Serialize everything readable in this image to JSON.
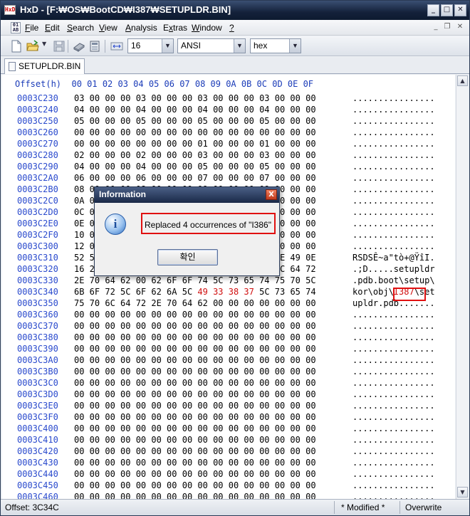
{
  "window": {
    "title": "HxD - [F:₩OS₩BootCD₩I387₩SETUPLDR.BIN]"
  },
  "menu": {
    "items": [
      {
        "label": "File",
        "u": "F",
        "rest": "ile"
      },
      {
        "label": "Edit",
        "u": "E",
        "rest": "dit"
      },
      {
        "label": "Search",
        "u": "S",
        "rest": "earch"
      },
      {
        "label": "View",
        "u": "V",
        "rest": "iew"
      },
      {
        "label": "Analysis",
        "u": "A",
        "rest": "nalysis"
      },
      {
        "label": "Extras",
        "u": "x",
        "pre": "E",
        "rest": "tras"
      },
      {
        "label": "Window",
        "u": "W",
        "rest": "indow"
      },
      {
        "label": "?",
        "u": "?",
        "rest": ""
      }
    ]
  },
  "toolbar": {
    "bytes_per_row": "16",
    "charset": "ANSI",
    "offset_base": "hex"
  },
  "tab": {
    "label": "SETUPLDR.BIN"
  },
  "editor": {
    "header": "Offset(h)  00 01 02 03 04 05 06 07 08 09 0A 0B 0C 0D 0E 0F",
    "rows": [
      {
        "off": "0003C230",
        "bytes": "03 00 00 00 03 00 00 00 03 00 00 00 03 00 00 00",
        "ascii": "................"
      },
      {
        "off": "0003C240",
        "bytes": "04 00 00 00 04 00 00 00 04 00 00 00 04 00 00 00",
        "ascii": "................"
      },
      {
        "off": "0003C250",
        "bytes": "05 00 00 00 05 00 00 00 05 00 00 00 05 00 00 00",
        "ascii": "................"
      },
      {
        "off": "0003C260",
        "bytes": "00 00 00 00 00 00 00 00 00 00 00 00 00 00 00 00",
        "ascii": "................"
      },
      {
        "off": "0003C270",
        "bytes": "00 00 00 00 00 00 00 00 01 00 00 00 01 00 00 00",
        "ascii": "................"
      },
      {
        "off": "0003C280",
        "bytes": "02 00 00 00 02 00 00 00 03 00 00 00 03 00 00 00",
        "ascii": "................"
      },
      {
        "off": "0003C290",
        "bytes": "04 00 00 00 04 00 00 00 05 00 00 00 05 00 00 00",
        "ascii": "................"
      },
      {
        "off": "0003C2A0",
        "bytes": "06 00 00 00 06 00 00 00 07 00 00 00 07 00 00 00",
        "ascii": "................"
      },
      {
        "off": "0003C2B0",
        "bytes": "08 00 00 00 08 00 00 00 09 00 00 00 09 00 00 00",
        "ascii": "................"
      },
      {
        "off": "0003C2C0",
        "bytes": "0A 00 00 00 0A 00 00 00 0B 00 00 00 0B 00 00 00",
        "ascii": "................"
      },
      {
        "off": "0003C2D0",
        "bytes": "0C 00 00 00 0C 00 00 00 0D 00 00 00 0D 00 00 00",
        "ascii": "................"
      },
      {
        "off": "0003C2E0",
        "bytes": "0E 00 00 00 0E 00 00 00 0F 00 00 00 0F 00 00 00",
        "ascii": "................"
      },
      {
        "off": "0003C2F0",
        "bytes": "10 00 00 00 10 00 00 00 11 00 00 00 11 00 00 00",
        "ascii": "................"
      },
      {
        "off": "0003C300",
        "bytes": "12 00 00 00 12 00 00 00 13 00 00 00 13 00 00 00",
        "ascii": "................"
      },
      {
        "off": "0003C310",
        "bytes": "52 53 44 53 CA 7E 61 22 74 F2 2B 40 9F EE 49 0E",
        "ascii": "RSDSÊ~a\"tò+@ŸîI."
      },
      {
        "off": "0003C320",
        "bytes": "16 2E 3B 44 01 00 00 00 73 65 74 75 70 6C 64 72",
        "ascii": ".;D.....setupldr"
      },
      {
        "off": "0003C330",
        "bytes": "2E 70 64 62 00 62 6F 6F 74 5C 73 65 74 75 70 5C",
        "ascii": ".pdb.boot\\setup\\"
      },
      {
        "off": "0003C340",
        "bytes_pre": "6B 6F 72 5C 6F 62 6A 5C ",
        "bytes_hl": "49 33 38 37",
        "bytes_post": " 5C 73 65 74",
        "ascii_pre": "kor\\obj\\",
        "ascii_hl": "I387",
        "ascii_post": "\\set"
      },
      {
        "off": "0003C350",
        "bytes": "75 70 6C 64 72 2E 70 64 62 00 00 00 00 00 00 00",
        "ascii": "upldr.pdb......."
      },
      {
        "off": "0003C360",
        "bytes": "00 00 00 00 00 00 00 00 00 00 00 00 00 00 00 00",
        "ascii": "................"
      },
      {
        "off": "0003C370",
        "bytes": "00 00 00 00 00 00 00 00 00 00 00 00 00 00 00 00",
        "ascii": "................"
      },
      {
        "off": "0003C380",
        "bytes": "00 00 00 00 00 00 00 00 00 00 00 00 00 00 00 00",
        "ascii": "................"
      },
      {
        "off": "0003C390",
        "bytes": "00 00 00 00 00 00 00 00 00 00 00 00 00 00 00 00",
        "ascii": "................"
      },
      {
        "off": "0003C3A0",
        "bytes": "00 00 00 00 00 00 00 00 00 00 00 00 00 00 00 00",
        "ascii": "................"
      },
      {
        "off": "0003C3B0",
        "bytes": "00 00 00 00 00 00 00 00 00 00 00 00 00 00 00 00",
        "ascii": "................"
      },
      {
        "off": "0003C3C0",
        "bytes": "00 00 00 00 00 00 00 00 00 00 00 00 00 00 00 00",
        "ascii": "................"
      },
      {
        "off": "0003C3D0",
        "bytes": "00 00 00 00 00 00 00 00 00 00 00 00 00 00 00 00",
        "ascii": "................"
      },
      {
        "off": "0003C3E0",
        "bytes": "00 00 00 00 00 00 00 00 00 00 00 00 00 00 00 00",
        "ascii": "................"
      },
      {
        "off": "0003C3F0",
        "bytes": "00 00 00 00 00 00 00 00 00 00 00 00 00 00 00 00",
        "ascii": "................"
      },
      {
        "off": "0003C400",
        "bytes": "00 00 00 00 00 00 00 00 00 00 00 00 00 00 00 00",
        "ascii": "................"
      },
      {
        "off": "0003C410",
        "bytes": "00 00 00 00 00 00 00 00 00 00 00 00 00 00 00 00",
        "ascii": "................"
      },
      {
        "off": "0003C420",
        "bytes": "00 00 00 00 00 00 00 00 00 00 00 00 00 00 00 00",
        "ascii": "................"
      },
      {
        "off": "0003C430",
        "bytes": "00 00 00 00 00 00 00 00 00 00 00 00 00 00 00 00",
        "ascii": "................"
      },
      {
        "off": "0003C440",
        "bytes": "00 00 00 00 00 00 00 00 00 00 00 00 00 00 00 00",
        "ascii": "................"
      },
      {
        "off": "0003C450",
        "bytes": "00 00 00 00 00 00 00 00 00 00 00 00 00 00 00 00",
        "ascii": "................"
      },
      {
        "off": "0003C460",
        "bytes": "00 00 00 00 00 00 00 00 00 00 00 00 00 00 00 00",
        "ascii": "................"
      }
    ]
  },
  "dialog": {
    "title": "Information",
    "message": "Replaced 4 occurrences of \"I386\"",
    "ok_label": "확인",
    "close_glyph": "X",
    "icon_glyph": "i"
  },
  "status": {
    "offset": "Offset: 3C34C",
    "modified": "* Modified *",
    "mode": "Overwrite"
  },
  "colors": {
    "offset_blue": "#2a4acd",
    "highlight_red": "#d01010",
    "annotation_red": "#e01010"
  }
}
